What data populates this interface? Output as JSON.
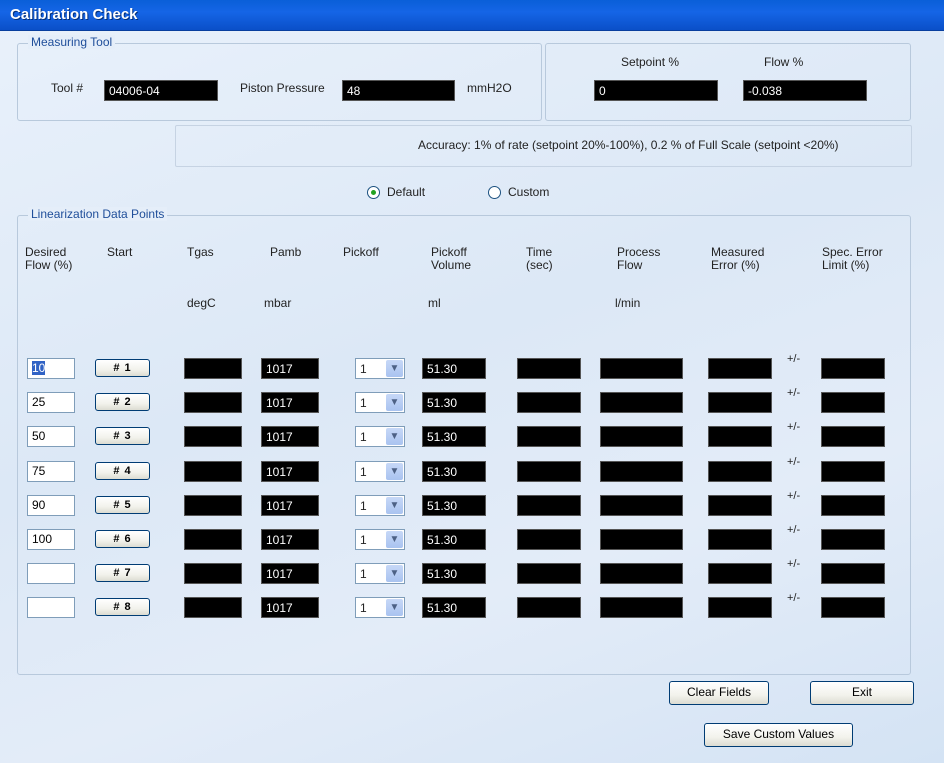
{
  "window": {
    "title": "Calibration Check"
  },
  "measuring_tool": {
    "legend": "Measuring Tool",
    "tool_label": "Tool #",
    "tool_value": "04006-04",
    "piston_label": "Piston Pressure",
    "piston_value": "48",
    "piston_unit": "mmH2O"
  },
  "setpoint_flow": {
    "setpoint_label": "Setpoint %",
    "setpoint_value": "0",
    "flow_label": "Flow %",
    "flow_value": "-0.038"
  },
  "accuracy_text": "Accuracy: 1% of rate (setpoint 20%-100%), 0.2 % of Full Scale (setpoint <20%)",
  "mode": {
    "default_label": "Default",
    "custom_label": "Custom",
    "selected": "Default"
  },
  "linearization": {
    "legend": "Linearization Data Points",
    "headers": {
      "desired_flow": [
        "Desired",
        "Flow (%)"
      ],
      "start": [
        "Start"
      ],
      "tgas": [
        "Tgas"
      ],
      "pamb": [
        "Pamb"
      ],
      "pickoff": [
        "Pickoff"
      ],
      "pickoff_volume": [
        "Pickoff",
        "Volume"
      ],
      "time": [
        "Time",
        "(sec)"
      ],
      "process_flow": [
        "Process",
        "Flow"
      ],
      "measured_error": [
        "Measured",
        "Error (%)"
      ],
      "spec_error": [
        "Spec. Error",
        "Limit (%)"
      ]
    },
    "units": {
      "tgas": "degC",
      "pamb": "mbar",
      "pickoff_volume": "ml",
      "process_flow": "l/min"
    },
    "plus_minus": "+/-",
    "rows": [
      {
        "desired": "10",
        "start": "# 1",
        "tgas": "",
        "pamb": "1017",
        "pickoff": "1",
        "volume": "51.30",
        "time": "",
        "process_flow": "",
        "measured_error": "",
        "spec_error": ""
      },
      {
        "desired": "25",
        "start": "# 2",
        "tgas": "",
        "pamb": "1017",
        "pickoff": "1",
        "volume": "51.30",
        "time": "",
        "process_flow": "",
        "measured_error": "",
        "spec_error": ""
      },
      {
        "desired": "50",
        "start": "# 3",
        "tgas": "",
        "pamb": "1017",
        "pickoff": "1",
        "volume": "51.30",
        "time": "",
        "process_flow": "",
        "measured_error": "",
        "spec_error": ""
      },
      {
        "desired": "75",
        "start": "# 4",
        "tgas": "",
        "pamb": "1017",
        "pickoff": "1",
        "volume": "51.30",
        "time": "",
        "process_flow": "",
        "measured_error": "",
        "spec_error": ""
      },
      {
        "desired": "90",
        "start": "# 5",
        "tgas": "",
        "pamb": "1017",
        "pickoff": "1",
        "volume": "51.30",
        "time": "",
        "process_flow": "",
        "measured_error": "",
        "spec_error": ""
      },
      {
        "desired": "100",
        "start": "# 6",
        "tgas": "",
        "pamb": "1017",
        "pickoff": "1",
        "volume": "51.30",
        "time": "",
        "process_flow": "",
        "measured_error": "",
        "spec_error": ""
      },
      {
        "desired": "",
        "start": "# 7",
        "tgas": "",
        "pamb": "1017",
        "pickoff": "1",
        "volume": "51.30",
        "time": "",
        "process_flow": "",
        "measured_error": "",
        "spec_error": ""
      },
      {
        "desired": "",
        "start": "# 8",
        "tgas": "",
        "pamb": "1017",
        "pickoff": "1",
        "volume": "51.30",
        "time": "",
        "process_flow": "",
        "measured_error": "",
        "spec_error": ""
      }
    ]
  },
  "buttons": {
    "clear": "Clear Fields",
    "exit": "Exit",
    "save": "Save  Custom Values"
  },
  "icons": {
    "combo_arrow": "chevron-down-icon"
  }
}
